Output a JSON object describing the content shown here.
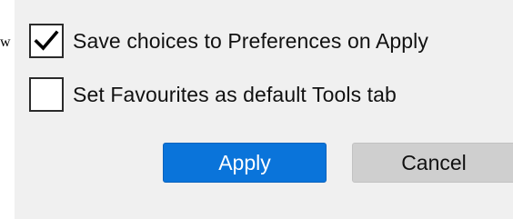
{
  "clipped_text": "w",
  "options": [
    {
      "label": "Save choices to Preferences on Apply",
      "checked": true
    },
    {
      "label": "Set Favourites as default Tools tab",
      "checked": false
    }
  ],
  "buttons": {
    "apply_label": "Apply",
    "cancel_label": "Cancel"
  },
  "colors": {
    "panel_bg": "#f0f0f0",
    "accent": "#0a74da",
    "secondary_button": "#cfcfcf"
  },
  "icons": {
    "checkmark": "checkmark-icon"
  }
}
